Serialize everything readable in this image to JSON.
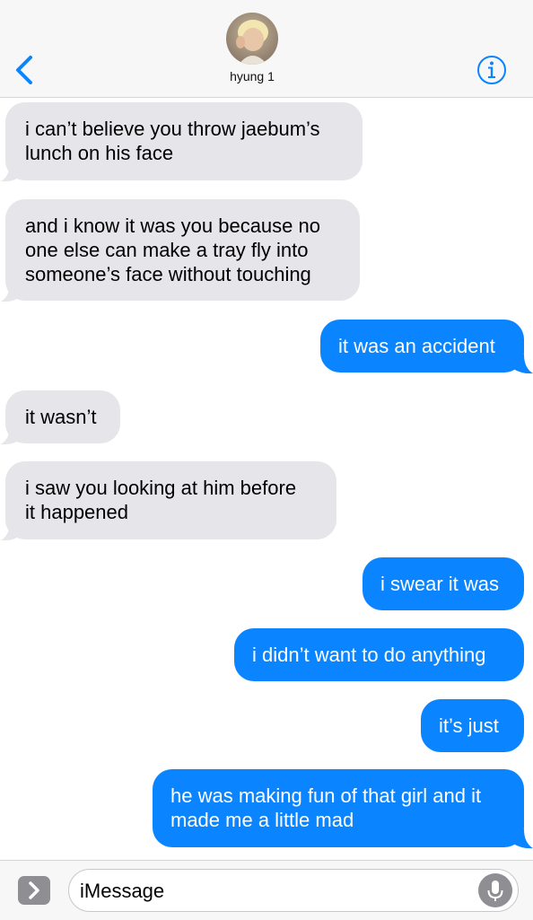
{
  "header": {
    "contact_name": "hyung 1",
    "back_icon": "chevron-left-icon",
    "info_icon": "info-icon"
  },
  "messages": [
    {
      "direction": "received",
      "lines": [
        "i can’t believe you throw jaebum’s",
        "lunch on his face"
      ]
    },
    {
      "direction": "received",
      "lines": [
        "and i know it was you because no",
        "one else can make a tray fly into",
        "someone’s face without touching"
      ]
    },
    {
      "direction": "sent",
      "lines": [
        "it was an accident"
      ]
    },
    {
      "direction": "received",
      "lines": [
        "it wasn’t"
      ]
    },
    {
      "direction": "received",
      "lines": [
        "i saw you looking at him before",
        "it happened"
      ]
    },
    {
      "direction": "sent",
      "lines": [
        "i swear it was"
      ]
    },
    {
      "direction": "sent",
      "lines": [
        "i didn’t want to do anything"
      ]
    },
    {
      "direction": "sent",
      "lines": [
        "it’s just"
      ]
    },
    {
      "direction": "sent",
      "lines": [
        "he was making fun of that girl and it",
        "made me a little mad"
      ]
    }
  ],
  "input": {
    "placeholder": "iMessage",
    "apps_icon": "chevron-right-icon",
    "mic_icon": "microphone-icon"
  },
  "colors": {
    "accent": "#0a84ff",
    "received_bubble": "#e5e5ea",
    "header_bg": "#f7f7f7"
  }
}
